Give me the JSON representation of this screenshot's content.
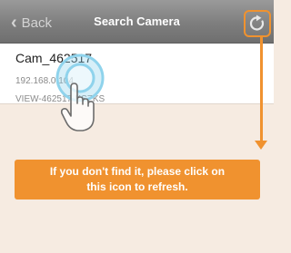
{
  "navbar": {
    "back_label": "Back",
    "title": "Search Camera",
    "refresh_icon": "refresh-icon"
  },
  "cameras": [
    {
      "name": "Cam_462517",
      "ip": "192.168.0.104",
      "id": "VIEW-462517-KSZKS"
    }
  ],
  "callout": {
    "text": "If you don't find it, please click on\nthis icon to refresh."
  },
  "colors": {
    "accent": "#f0922f",
    "navbar": "#7e7e7e",
    "background": "#f6ebe1"
  }
}
